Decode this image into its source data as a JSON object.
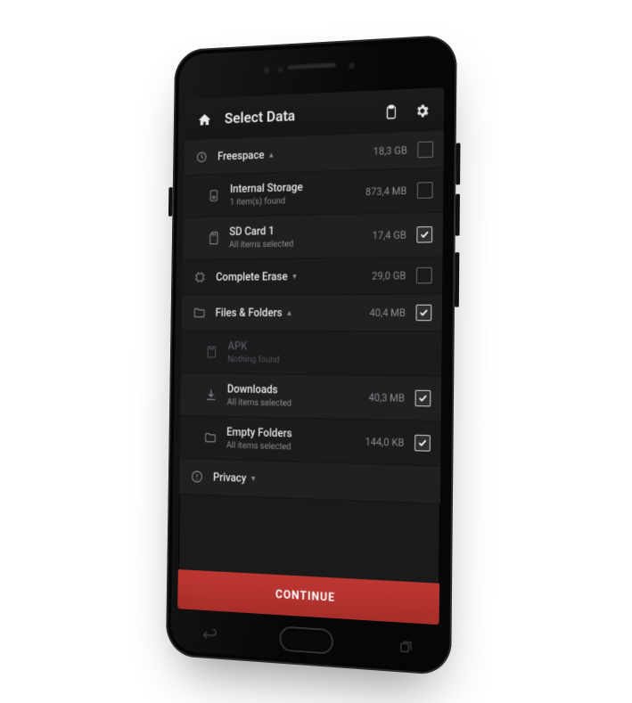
{
  "appbar": {
    "title": "Select Data",
    "home_icon": "home",
    "clipboard_icon": "clipboard",
    "settings_icon": "settings"
  },
  "rows": [
    {
      "id": "freespace",
      "icon": "wipe",
      "label": "Freespace",
      "chevron": "up",
      "sub": "",
      "size": "18,3 GB",
      "checked": false,
      "disabled": false,
      "indent": false
    },
    {
      "id": "internal",
      "icon": "storage",
      "label": "Internal Storage",
      "chevron": "",
      "sub": "1 item(s) found",
      "size": "873,4 MB",
      "checked": false,
      "disabled": false,
      "indent": true
    },
    {
      "id": "sdcard1",
      "icon": "sd",
      "label": "SD Card 1",
      "chevron": "",
      "sub": "All items selected",
      "size": "17,4 GB",
      "checked": true,
      "disabled": false,
      "indent": true
    },
    {
      "id": "complete-erase",
      "icon": "chip",
      "label": "Complete Erase",
      "chevron": "down",
      "sub": "",
      "size": "29,0 GB",
      "checked": false,
      "disabled": false,
      "indent": false
    },
    {
      "id": "files-folders",
      "icon": "folder",
      "label": "Files & Folders",
      "chevron": "up",
      "sub": "",
      "size": "40,4 MB",
      "checked": true,
      "disabled": false,
      "indent": false
    },
    {
      "id": "apk",
      "icon": "apk",
      "label": "APK",
      "chevron": "",
      "sub": "Nothing found",
      "size": "",
      "checked": null,
      "disabled": true,
      "indent": true
    },
    {
      "id": "downloads",
      "icon": "download",
      "label": "Downloads",
      "chevron": "",
      "sub": "All items selected",
      "size": "40,3 MB",
      "checked": true,
      "disabled": false,
      "indent": true
    },
    {
      "id": "empty-folders",
      "icon": "folder",
      "label": "Empty Folders",
      "chevron": "",
      "sub": "All items selected",
      "size": "144,0 KB",
      "checked": true,
      "disabled": false,
      "indent": true
    },
    {
      "id": "privacy",
      "icon": "privacy",
      "label": "Privacy",
      "chevron": "down",
      "sub": "",
      "size": "",
      "checked": null,
      "disabled": false,
      "indent": false
    }
  ],
  "cta": {
    "label": "CONTINUE"
  }
}
